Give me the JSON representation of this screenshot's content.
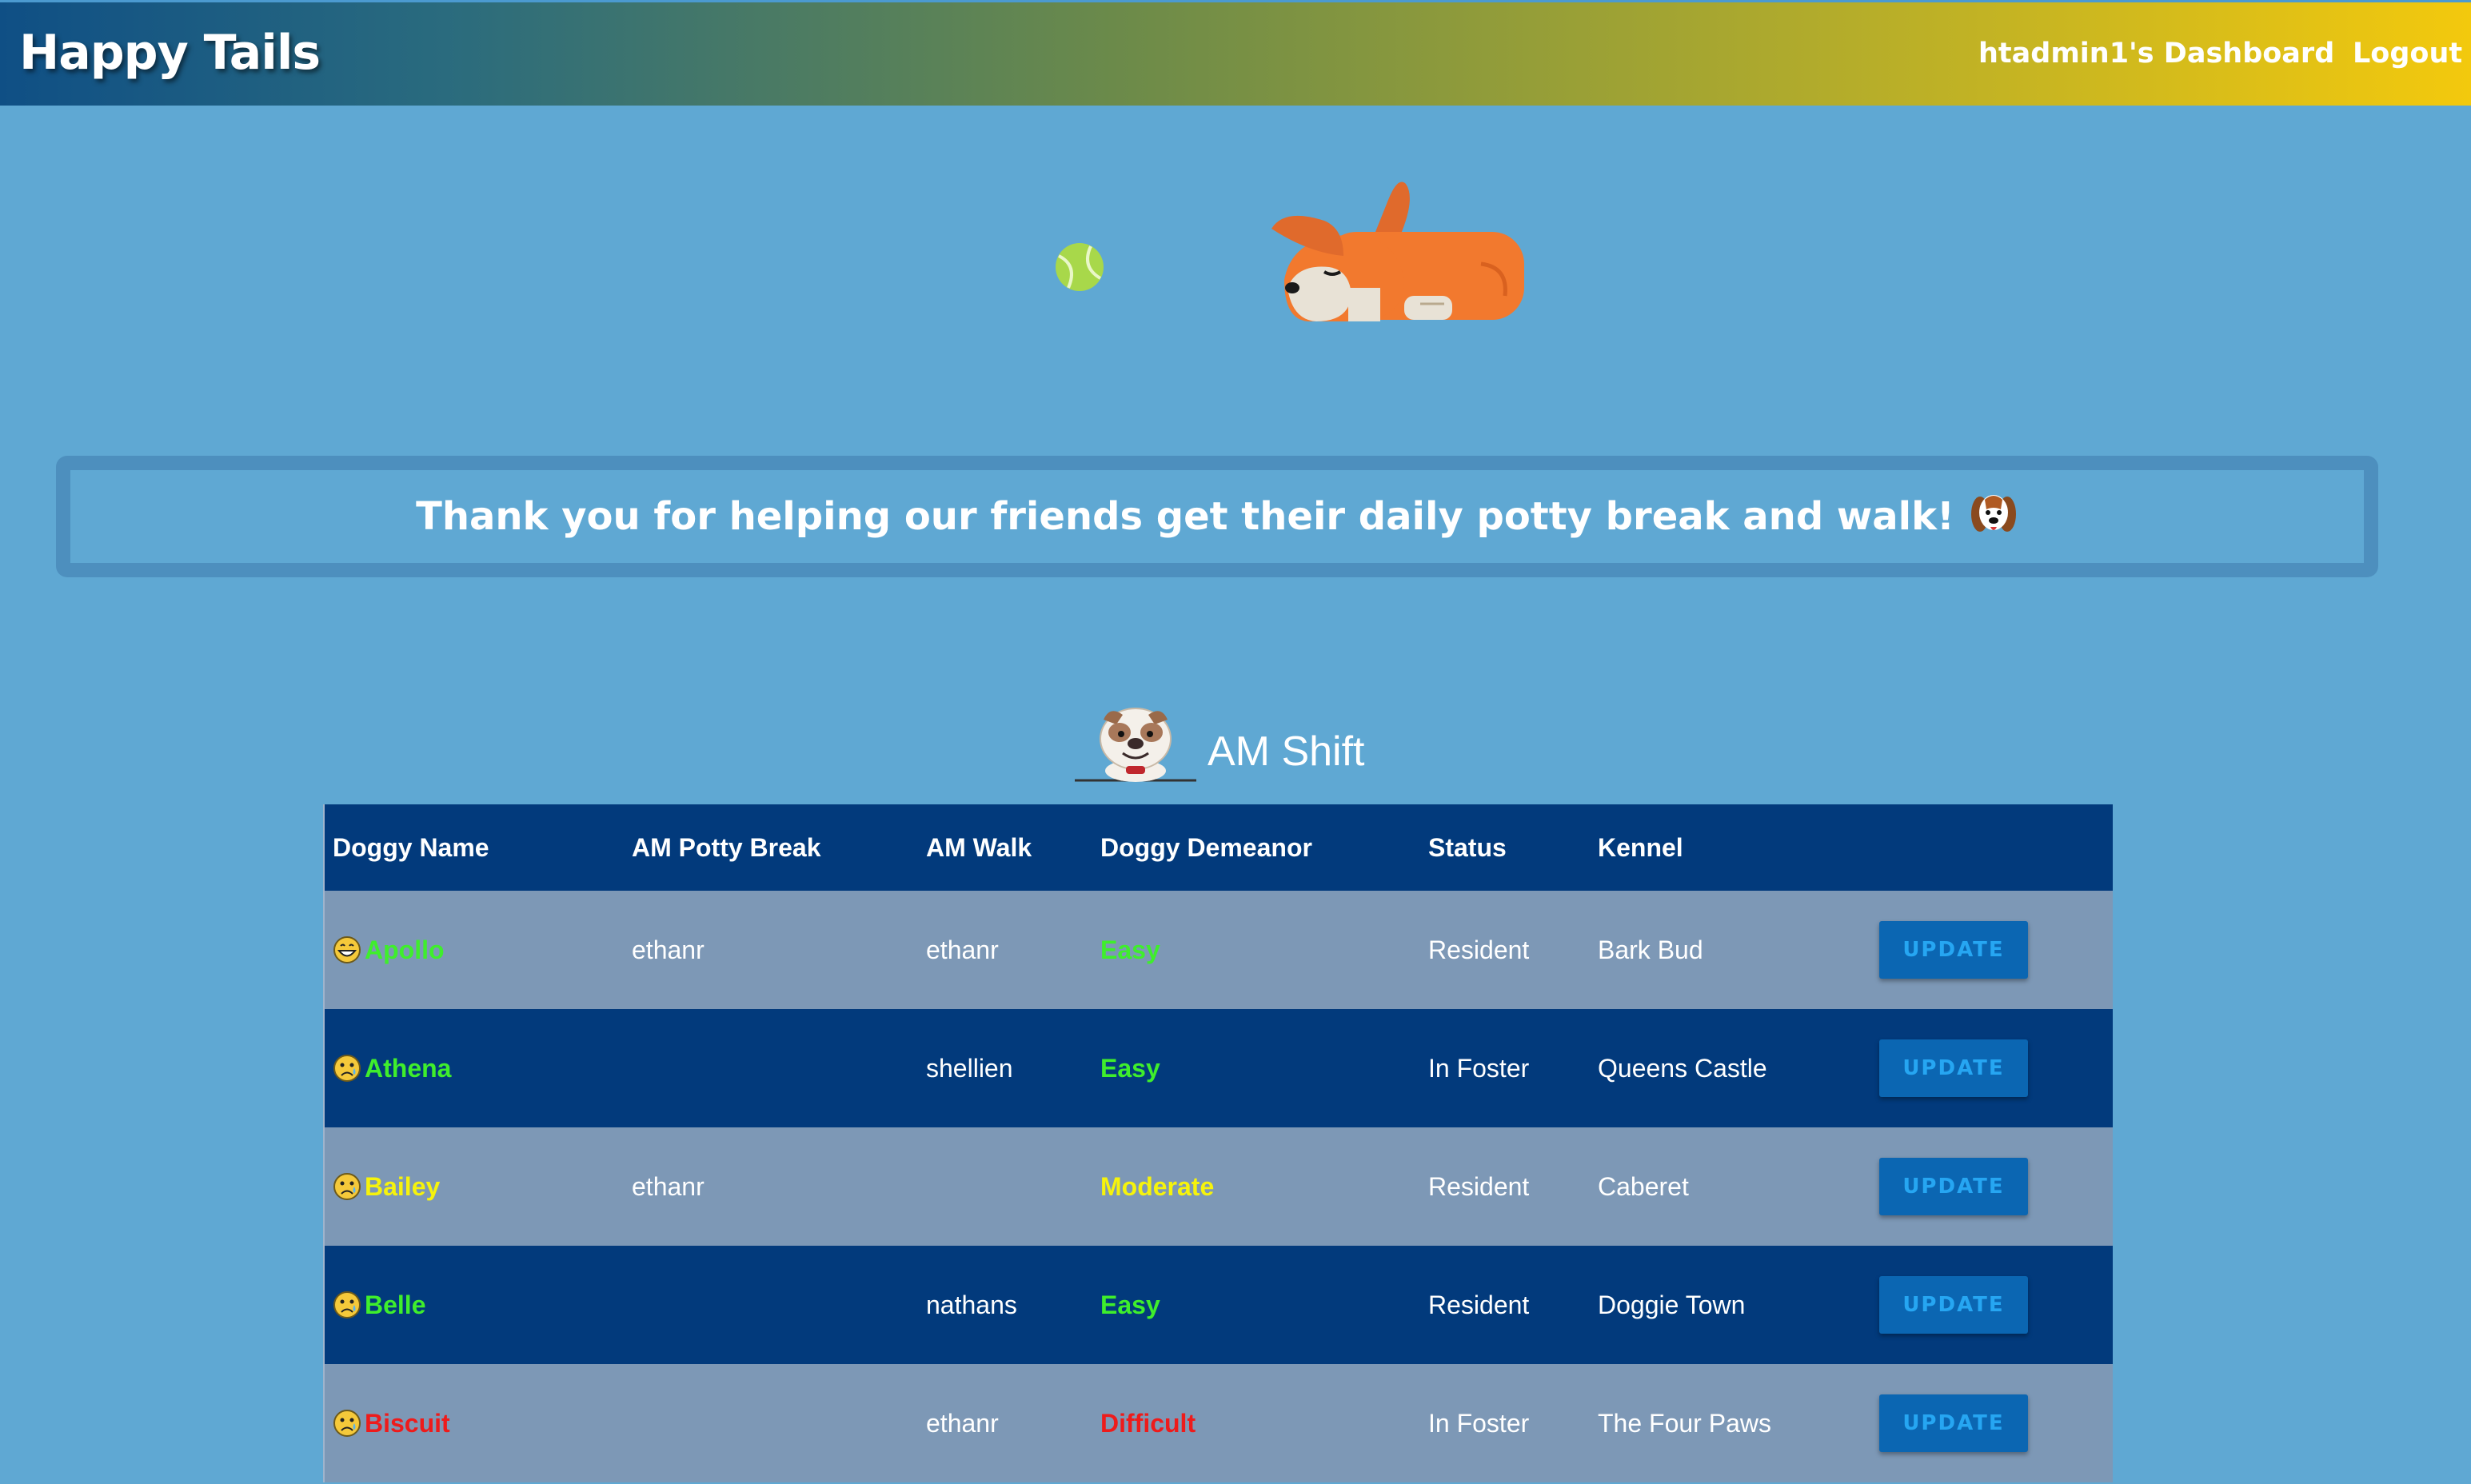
{
  "navbar": {
    "brand": "Happy Tails",
    "dashboard_label": "htadmin1's Dashboard",
    "logout_label": "Logout"
  },
  "banner": {
    "message": "Thank you for helping our friends get their daily potty break and walk!"
  },
  "shift": {
    "title": "AM Shift"
  },
  "table": {
    "headers": [
      "Doggy Name",
      "AM Potty Break",
      "AM Walk",
      "Doggy Demeanor",
      "Status",
      "Kennel",
      ""
    ],
    "rows": [
      {
        "name": "Apollo",
        "mood_icon": "grin-face-icon",
        "potty": "ethanr",
        "walk": "ethanr",
        "demeanor": "Easy",
        "demeanor_color": "#3fee2c",
        "status": "Resident",
        "kennel": "Bark Bud",
        "action": "UPDATE"
      },
      {
        "name": "Athena",
        "mood_icon": "sad-face-icon",
        "potty": "",
        "walk": "shellien",
        "demeanor": "Easy",
        "demeanor_color": "#3fee2c",
        "status": "In Foster",
        "kennel": "Queens Castle",
        "action": "UPDATE"
      },
      {
        "name": "Bailey",
        "mood_icon": "sad-face-icon",
        "potty": "ethanr",
        "walk": "",
        "demeanor": "Moderate",
        "demeanor_color": "#f6f30c",
        "status": "Resident",
        "kennel": "Caberet",
        "action": "UPDATE"
      },
      {
        "name": "Belle",
        "mood_icon": "sad-face-icon",
        "potty": "",
        "walk": "nathans",
        "demeanor": "Easy",
        "demeanor_color": "#3fee2c",
        "status": "Resident",
        "kennel": "Doggie Town",
        "action": "UPDATE"
      },
      {
        "name": "Biscuit",
        "mood_icon": "sad-face-icon",
        "potty": "",
        "walk": "ethanr",
        "demeanor": "Difficult",
        "demeanor_color": "#ee1b1b",
        "status": "In Foster",
        "kennel": "The Four Paws",
        "action": "UPDATE"
      }
    ]
  },
  "colors": {
    "background": "#5fa8d3",
    "table_header": "#023a7c",
    "row_light": "#7d98b6",
    "row_dark": "#023a7c",
    "easy": "#3fee2c",
    "moderate": "#f6f30c",
    "difficult": "#ee1b1b"
  }
}
